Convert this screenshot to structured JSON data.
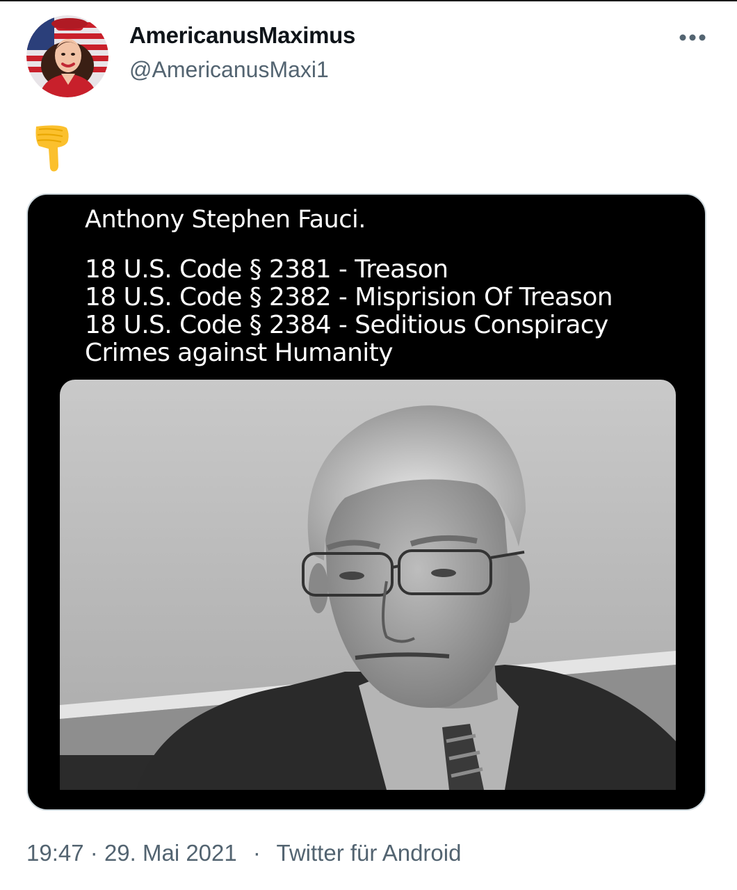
{
  "author": {
    "display_name": "AmericanusMaximus",
    "handle": "@AmericanusMaxi1",
    "avatar_icon": "avatar-vintage-woman-flag"
  },
  "more_icon": "more-horizontal-icon",
  "tweet": {
    "body_emoji": "👇",
    "body_icon": "backhand-index-pointing-down-icon"
  },
  "media": {
    "title": "Anthony Stephen Fauci.",
    "lines": [
      "18 U.S. Code § 2381 - Treason",
      "18 U.S. Code § 2382 - Misprision Of Treason",
      "18 U.S. Code § 2384 - Seditious Conspiracy",
      "Crimes against Humanity"
    ],
    "photo_description_icon": "grayscale-portrait-photo"
  },
  "meta": {
    "time": "19:47",
    "date": "29. Mai 2021",
    "separator": "·",
    "source": "Twitter für Android"
  },
  "colors": {
    "text": "#0f1419",
    "secondary": "#536471",
    "media_bg": "#000000",
    "border": "#cfd9de"
  }
}
